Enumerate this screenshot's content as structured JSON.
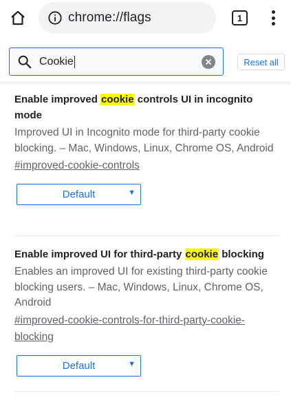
{
  "toolbar": {
    "home_icon": "home-icon",
    "info_icon": "info-icon",
    "url": "chrome://flags",
    "tab_count": "1",
    "menu_icon": "more-vert-icon"
  },
  "search": {
    "value": "Cookie",
    "search_icon": "search-icon",
    "clear_icon": "clear-icon",
    "reset_label": "Reset all"
  },
  "experiments": [
    {
      "title_before": "Enable improved ",
      "title_highlight": "cookie",
      "title_after": " controls UI in incognito mode",
      "description": "Improved UI in Incognito mode for third-party cookie blocking. – Mac, Windows, Linux, Chrome OS, Android",
      "link": "#improved-cookie-controls",
      "select_value": "Default"
    },
    {
      "title_before": "Enable improved UI for third-party ",
      "title_highlight": "cookie",
      "title_after": " blocking",
      "description": "Enables an improved UI for existing third-party cookie blocking users. – Mac, Windows, Linux, Chrome OS, Android",
      "link": "#improved-cookie-controls-for-third-party-cookie-blocking",
      "select_value": "Default"
    }
  ],
  "colors": {
    "accent": "#1a73e8",
    "highlight": "#fdfd00",
    "secondary_text": "#5f6368"
  }
}
